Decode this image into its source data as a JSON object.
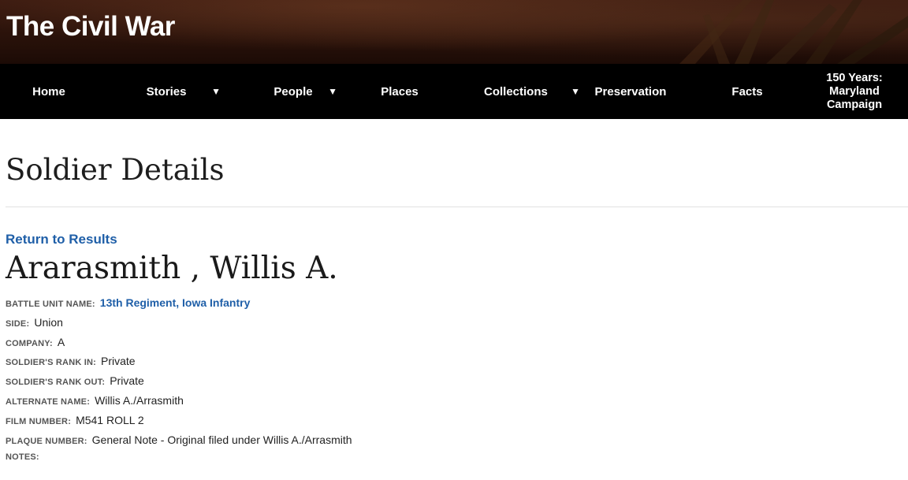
{
  "header": {
    "site_title": "The Civil War"
  },
  "nav": {
    "items": [
      {
        "label": "Home",
        "has_dropdown": false
      },
      {
        "label": "Stories",
        "has_dropdown": true
      },
      {
        "label": "People",
        "has_dropdown": true
      },
      {
        "label": "Places",
        "has_dropdown": false
      },
      {
        "label": "Collections",
        "has_dropdown": true
      },
      {
        "label": "Preservation",
        "has_dropdown": false
      },
      {
        "label": "Facts",
        "has_dropdown": false
      },
      {
        "label_lines": [
          "150 Years:",
          "Maryland",
          "Campaign"
        ],
        "has_dropdown": false
      }
    ],
    "dropdown_glyph": "▼"
  },
  "page": {
    "title": "Soldier Details",
    "return_link": "Return to Results",
    "soldier_name": "Ararasmith , Willis A."
  },
  "details": {
    "battle_unit": {
      "label": "Battle Unit Name:",
      "value": "13th Regiment, Iowa Infantry"
    },
    "side": {
      "label": "Side:",
      "value": "Union"
    },
    "company": {
      "label": "Company:",
      "value": "A"
    },
    "rank_in": {
      "label": "Soldier's Rank In:",
      "value": "Private"
    },
    "rank_out": {
      "label": "Soldier's Rank Out:",
      "value": "Private"
    },
    "alternate_name": {
      "label": "Alternate Name:",
      "value": "Willis A./Arrasmith"
    },
    "film_number": {
      "label": "Film Number:",
      "value": "M541 ROLL 2"
    },
    "plaque_number": {
      "label": "Plaque Number:",
      "value": "General Note - Original filed under Willis A./Arrasmith"
    },
    "notes": {
      "label": "Notes:",
      "value": ""
    }
  },
  "colors": {
    "nav_background": "#000000",
    "link": "#1f5fa8",
    "banner": "#2a120a"
  }
}
